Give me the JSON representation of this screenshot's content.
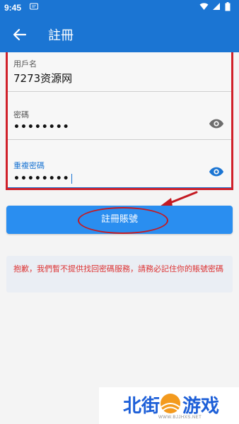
{
  "status_bar": {
    "time": "9:45",
    "notification_icon": "message-icon",
    "icons": [
      "wifi-icon",
      "signal-icon",
      "battery-icon"
    ]
  },
  "app_bar": {
    "title": "註冊",
    "back_icon": "arrow-left-icon",
    "background": "#1b75d3"
  },
  "form": {
    "username": {
      "label": "用戶名",
      "value": "7273资源网"
    },
    "password": {
      "label": "密碼",
      "value": "••••••••",
      "eye_icon": "eye-icon"
    },
    "confirm_password": {
      "label": "重複密碼",
      "value": "••••••••",
      "eye_icon": "eye-icon"
    }
  },
  "register_button": {
    "label": "註冊賬號",
    "color": "#2a8ef0"
  },
  "warning": {
    "text": "抱歉，我們暫不提供找回密碼服務，請務必記住你的賬號密碼",
    "color": "#d33333"
  },
  "watermark": {
    "text_left": "北街",
    "text_right": "游戏",
    "small": "WWW.BJJHXS.NET"
  }
}
